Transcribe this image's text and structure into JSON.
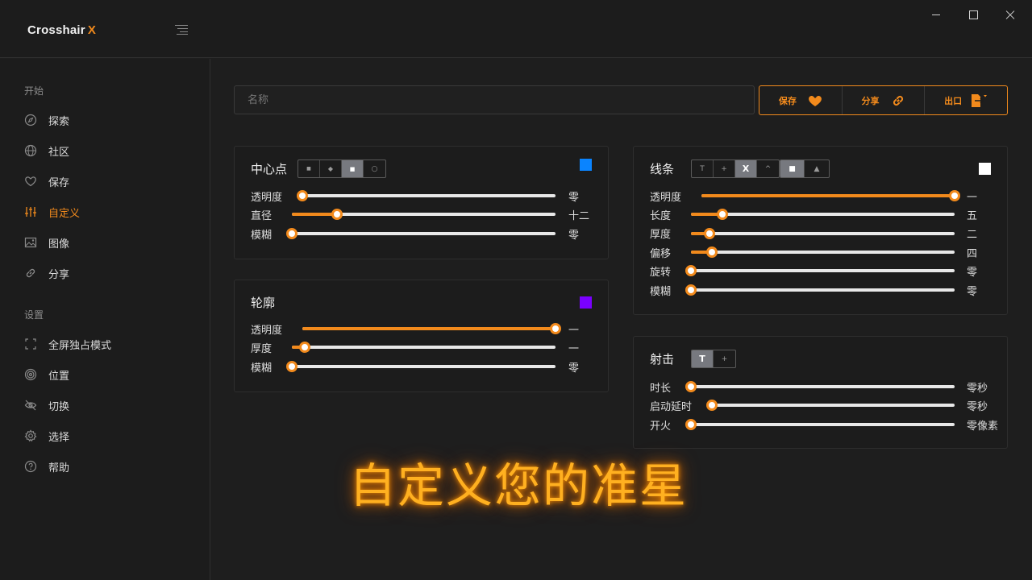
{
  "app": {
    "logo_text": "Crosshair",
    "logo_accent": "X",
    "accent_color": "#f28a1c"
  },
  "sidebar": {
    "section_start": "开始",
    "section_settings": "设置",
    "start_items": [
      {
        "label": "探索",
        "icon": "compass-icon"
      },
      {
        "label": "社区",
        "icon": "globe-icon"
      },
      {
        "label": "保存",
        "icon": "heart-icon"
      },
      {
        "label": "自定义",
        "icon": "sliders-icon",
        "active": true
      },
      {
        "label": "图像",
        "icon": "image-icon"
      },
      {
        "label": "分享",
        "icon": "link-icon"
      }
    ],
    "settings_items": [
      {
        "label": "全屏独占模式",
        "icon": "fullscreen-icon"
      },
      {
        "label": "位置",
        "icon": "target-icon"
      },
      {
        "label": "切换",
        "icon": "eye-off-icon"
      },
      {
        "label": "选择",
        "icon": "gear-icon"
      },
      {
        "label": "帮助",
        "icon": "help-icon"
      }
    ]
  },
  "toolbar": {
    "name_placeholder": "名称",
    "save_label": "保存",
    "share_label": "分享",
    "export_label": "出口"
  },
  "center_dot": {
    "title": "中心点",
    "shapes": [
      "■",
      "◆",
      "■",
      "○"
    ],
    "selected_shape": 2,
    "color": "#0a84ff",
    "rows": [
      {
        "label": "透明度",
        "value": "零",
        "level": 0
      },
      {
        "label": "直径",
        "value": "十二",
        "level": 0.17
      },
      {
        "label": "模糊",
        "value": "零",
        "level": 0
      }
    ]
  },
  "outline": {
    "title": "轮廓",
    "color": "#7a00ff",
    "rows": [
      {
        "label": "透明度",
        "value": "一",
        "level": 1
      },
      {
        "label": "厚度",
        "value": "一",
        "level": 0.05
      },
      {
        "label": "模糊",
        "value": "零",
        "level": 0
      }
    ]
  },
  "lines": {
    "title": "线条",
    "styles": [
      "T",
      "+",
      "X",
      "^"
    ],
    "selected_style": 2,
    "caps": [
      "■",
      "▲"
    ],
    "selected_cap": 0,
    "color": "#ffffff",
    "rows": [
      {
        "label": "透明度",
        "value": "一",
        "level": 1
      },
      {
        "label": "长度",
        "value": "五",
        "level": 0.12
      },
      {
        "label": "厚度",
        "value": "二",
        "level": 0.07
      },
      {
        "label": "偏移",
        "value": "四",
        "level": 0.08
      },
      {
        "label": "旋转",
        "value": "零",
        "level": 0
      },
      {
        "label": "模糊",
        "value": "零",
        "level": 0
      }
    ]
  },
  "shooting": {
    "title": "射击",
    "modes": [
      "T",
      "+"
    ],
    "selected_mode": 0,
    "rows": [
      {
        "label": "时长",
        "value": "零秒",
        "level": 0
      },
      {
        "label": "启动延时",
        "value": "零秒",
        "level": 0
      },
      {
        "label": "开火",
        "value": "零像素",
        "level": 0
      }
    ]
  },
  "headline": "自定义您的准星"
}
